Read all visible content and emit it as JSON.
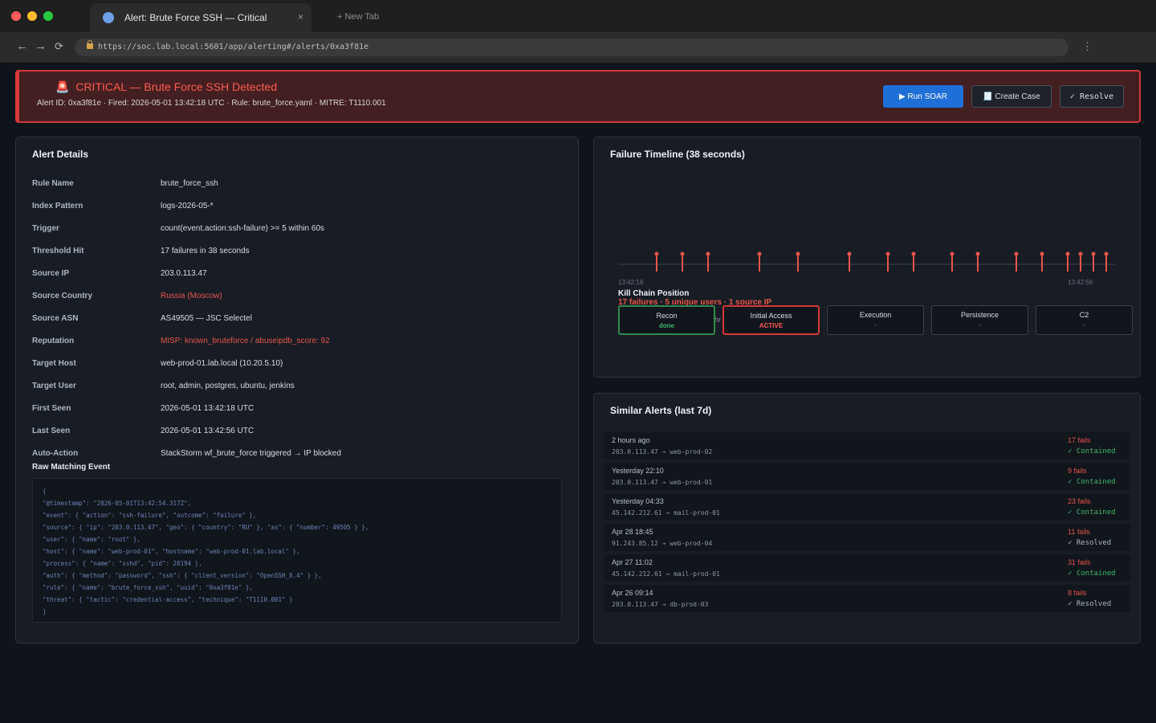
{
  "colors": {
    "critical": "#ff5a4e",
    "success": "#3bb86a",
    "primary": "#1f6fd8",
    "timeline_marker": "#e8554a",
    "traffic_lights": [
      "#ff5f57",
      "#febc2e",
      "#28c840"
    ]
  },
  "browser": {
    "tab_title": "Alert: Brute Force SSH — Critical",
    "tab_close": "×",
    "new_tab": "+ New Tab",
    "back": "←",
    "forward": "→",
    "reload": "⟳",
    "url": "https://soc.lab.local:5601/app/alerting#/alerts/0xa3f81e",
    "menu": "⋮"
  },
  "banner": {
    "icon": "🚨",
    "title": "CRITICAL — Brute Force SSH Detected",
    "meta": "Alert ID: 0xa3f81e · Fired: 2026-05-01 13:42:18 UTC · Rule: brute_force.yaml · MITRE: T1110.001",
    "actions": {
      "run_soar": "▶ Run SOAR",
      "create_case": "🧾 Create Case",
      "resolve": "✓ Resolve"
    }
  },
  "details": {
    "title": "Alert Details",
    "fields": [
      {
        "label": "Rule Name",
        "value": "brute_force_ssh"
      },
      {
        "label": "Index Pattern",
        "value": "logs-2026-05-*"
      },
      {
        "label": "Trigger",
        "value": "count(event.action:ssh-failure) >= 5 within 60s"
      },
      {
        "label": "Threshold Hit",
        "value": "17 failures in 38 seconds"
      },
      {
        "label": "Source IP",
        "value": "203.0.113.47"
      },
      {
        "label": "Source Country",
        "value": "Russia (Moscow)"
      },
      {
        "label": "Source ASN",
        "value": "AS49505 — JSC Selectel"
      },
      {
        "label": "Reputation",
        "value": "MISP: known_bruteforce / abuseipdb_score: 92"
      },
      {
        "label": "Target Host",
        "value": "web-prod-01.lab.local (10.20.5.10)"
      },
      {
        "label": "Target User",
        "value": "root, admin, postgres, ubuntu, jenkins"
      },
      {
        "label": "First Seen",
        "value": "2026-05-01 13:42:18 UTC"
      },
      {
        "label": "Last Seen",
        "value": "2026-05-01 13:42:56 UTC"
      },
      {
        "label": "Auto-Action",
        "value": "StackStorm wf_brute_force triggered → IP blocked"
      }
    ],
    "raw_label": "Raw Matching Event",
    "raw_event": [
      "{",
      "\"@timestamp\": \"2026-05-01T13:42:54.317Z\",",
      "\"event\": { \"action\": \"ssh-failure\", \"outcome\": \"failure\" },",
      "\"source\": { \"ip\": \"203.0.113.47\", \"geo\": { \"country\": \"RU\" }, \"as\": { \"number\": 49505 } },",
      "\"user\": { \"name\": \"root\" },",
      "\"host\": { \"name\": \"web-prod-01\", \"hostname\": \"web-prod-01.lab.local\" },",
      "\"process\": { \"name\": \"sshd\", \"pid\": 28194 },",
      "\"auth\": { \"method\": \"password\", \"ssh\": { \"client_version\": \"OpenSSH_8.4\" } },",
      "\"rule\": { \"name\": \"brute_force_ssh\", \"uuid\": \"0xa3f81e\" },",
      "\"threat\": { \"tactic\": \"credential-access\", \"technique\": \"T1110.001\" }",
      "}"
    ]
  },
  "timeline": {
    "title": "Failure Timeline (38 seconds)",
    "start_label": "13:42:18",
    "end_label": "13:42:56",
    "duration_seconds": 38,
    "failure_offsets_seconds": [
      3,
      5,
      7,
      11,
      14,
      18,
      21,
      23,
      26,
      28,
      31,
      33,
      35,
      36,
      37,
      38
    ],
    "kill_chain": {
      "title": "Kill Chain Position",
      "summary": "17 failures · 5 unique users · 1 source IP",
      "stray_text": "hr",
      "stages": [
        {
          "name": "Recon",
          "status": "done",
          "state": "done"
        },
        {
          "name": "Initial Access",
          "status": "ACTIVE",
          "state": "active"
        },
        {
          "name": "Execution",
          "status": "-",
          "state": "pending"
        },
        {
          "name": "Persistence",
          "status": "-",
          "state": "pending"
        },
        {
          "name": "C2",
          "status": "-",
          "state": "pending"
        }
      ]
    }
  },
  "similar": {
    "title": "Similar Alerts (last 7d)",
    "rows": [
      {
        "when": "2 hours ago",
        "route": "203.0.113.47 → web-prod-02",
        "fails": "17 fails",
        "status": "✓ Contained",
        "state": "contained"
      },
      {
        "when": "Yesterday 22:10",
        "route": "203.0.113.47 → web-prod-01",
        "fails": "9 fails",
        "status": "✓ Contained",
        "state": "contained"
      },
      {
        "when": "Yesterday 04:33",
        "route": "45.142.212.61 → mail-prod-01",
        "fails": "23 fails",
        "status": "✓ Contained",
        "state": "contained"
      },
      {
        "when": "Apr 28 18:45",
        "route": "91.243.85.12 → web-prod-04",
        "fails": "11 fails",
        "status": "✓ Resolved",
        "state": "resolved"
      },
      {
        "when": "Apr 27 11:02",
        "route": "45.142.212.61 → mail-prod-01",
        "fails": "31 fails",
        "status": "✓ Contained",
        "state": "contained"
      },
      {
        "when": "Apr 26 09:14",
        "route": "203.0.113.47 → db-prod-03",
        "fails": "8 fails",
        "status": "✓ Resolved",
        "state": "resolved"
      }
    ]
  }
}
